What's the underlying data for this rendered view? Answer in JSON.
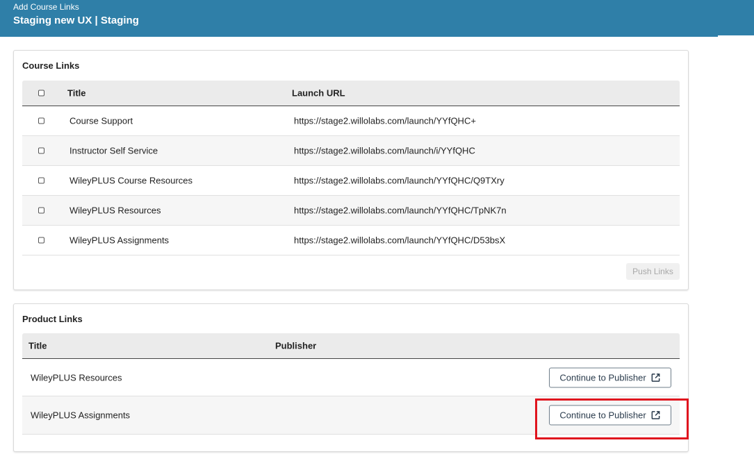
{
  "header": {
    "subtitle": "Add Course Links",
    "title": "Staging new UX | Staging"
  },
  "course_links": {
    "title": "Course Links",
    "columns": {
      "title": "Title",
      "launch_url": "Launch URL"
    },
    "rows": [
      {
        "title": "Course Support",
        "url": "https://stage2.willolabs.com/launch/YYfQHC+"
      },
      {
        "title": "Instructor Self Service",
        "url": "https://stage2.willolabs.com/launch/i/YYfQHC"
      },
      {
        "title": "WileyPLUS Course Resources",
        "url": "https://stage2.willolabs.com/launch/YYfQHC/Q9TXry"
      },
      {
        "title": "WileyPLUS Resources",
        "url": "https://stage2.willolabs.com/launch/YYfQHC/TpNK7n"
      },
      {
        "title": "WileyPLUS Assignments",
        "url": "https://stage2.willolabs.com/launch/YYfQHC/D53bsX"
      }
    ],
    "push_button": "Push Links"
  },
  "product_links": {
    "title": "Product Links",
    "columns": {
      "title": "Title",
      "publisher": "Publisher"
    },
    "rows": [
      {
        "title": "WileyPLUS Resources",
        "button": "Continue to Publisher"
      },
      {
        "title": "WileyPLUS Assignments",
        "button": "Continue to Publisher"
      }
    ]
  },
  "icons": {
    "external": "external-link-icon"
  },
  "colors": {
    "header_bg": "#2f7fa8",
    "highlight": "#e0141e"
  }
}
